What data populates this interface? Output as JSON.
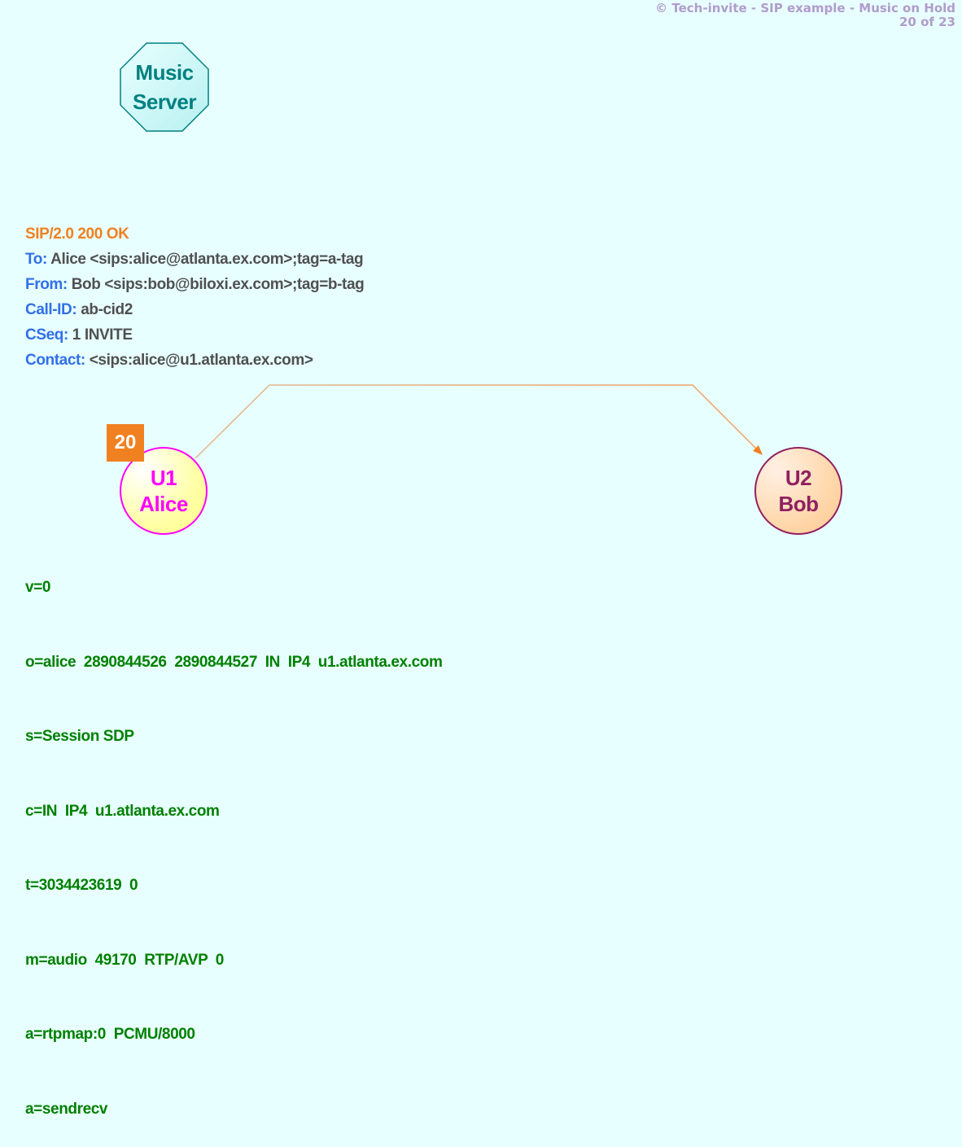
{
  "header": {
    "title": "© Tech-invite - SIP example - Music on Hold",
    "page_indicator": "20 of 23"
  },
  "colors": {
    "background": "#e8ffff",
    "header_text": "#b09ccb",
    "music_server": "#008080",
    "sip_status": "#f08020",
    "sip_header_name": "#3070e8",
    "sip_header_value": "#505050",
    "sdp_text": "#008000",
    "alice": "#ff00ff",
    "bob": "#902060",
    "arrow": "#f08020",
    "step_badge": "#f08020"
  },
  "music_server": {
    "line1": "Music",
    "line2": "Server",
    "shape": "octagon"
  },
  "sip_message": {
    "status_line": "SIP/2.0 200 OK",
    "headers": [
      {
        "name": "To",
        "value": " Alice <sips:alice@atlanta.ex.com>;tag=a-tag"
      },
      {
        "name": "From",
        "value": " Bob <sips:bob@biloxi.ex.com>;tag=b-tag"
      },
      {
        "name": "Call-ID",
        "value": " ab-cid2"
      },
      {
        "name": "CSeq",
        "value": " 1 INVITE"
      },
      {
        "name": "Contact",
        "value": " <sips:alice@u1.atlanta.ex.com>"
      }
    ]
  },
  "step_number": "20",
  "nodes": {
    "alice": {
      "line1": "U1",
      "line2": "Alice"
    },
    "bob": {
      "line1": "U2",
      "line2": "Bob"
    }
  },
  "arrow": {
    "from": "U1 Alice",
    "to": "U2 Bob"
  },
  "sdp": [
    "v=0",
    "o=alice  2890844526  2890844527  IN  IP4  u1.atlanta.ex.com",
    "s=Session SDP",
    "c=IN  IP4  u1.atlanta.ex.com",
    "t=3034423619  0",
    "m=audio  49170  RTP/AVP  0",
    "a=rtpmap:0  PCMU/8000",
    "a=sendrecv"
  ]
}
